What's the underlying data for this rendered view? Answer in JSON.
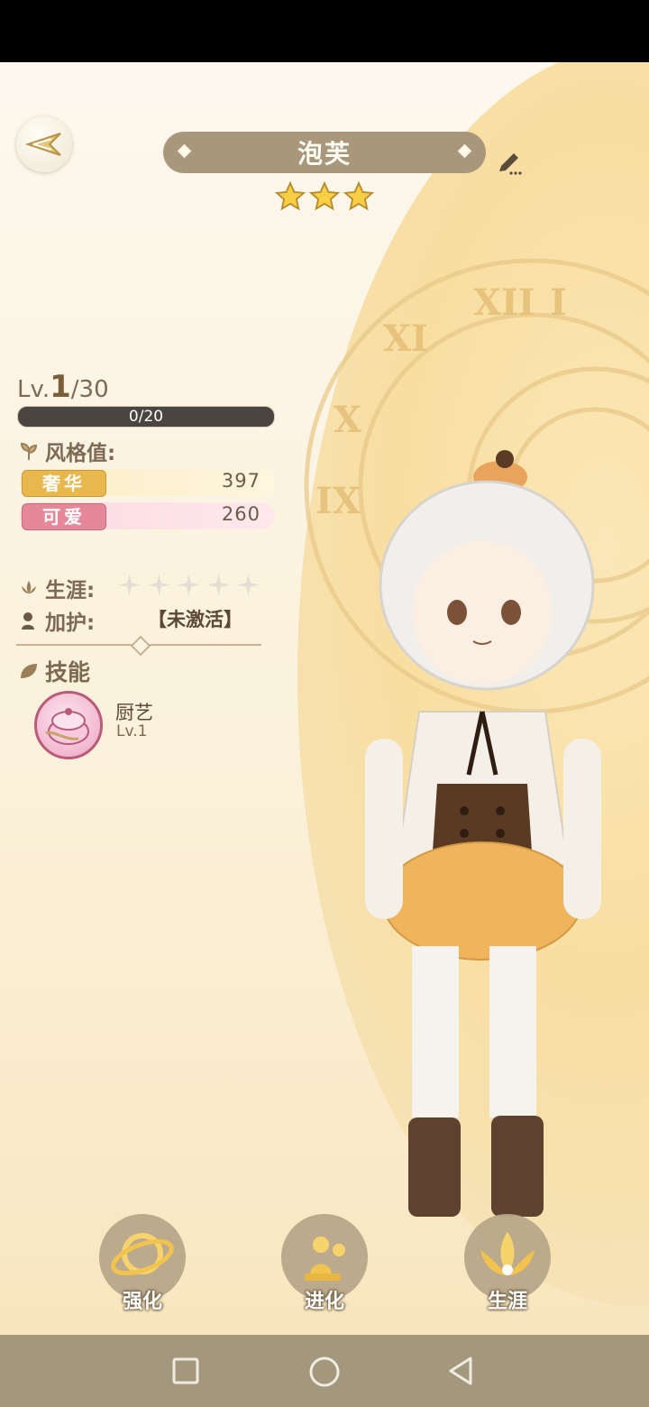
{
  "header": {
    "character_name": "泡芙",
    "rarity_stars": 3
  },
  "stats": {
    "level_prefix": "Lv.",
    "level_current": "1",
    "level_max": "/30",
    "xp_text": "0/20",
    "style_title": "风格值:",
    "styles": [
      {
        "tag": "奢华",
        "value": "397",
        "color": "#e8b84f"
      },
      {
        "tag": "可爱",
        "value": "260",
        "color": "#e4889a"
      }
    ],
    "career_label": "生涯:",
    "career_stars": 5,
    "protect_label": "加护:",
    "protect_value": "【未激活】"
  },
  "skills": {
    "title": "技能",
    "items": [
      {
        "name": "厨艺",
        "level": "Lv.1"
      }
    ]
  },
  "actions": [
    {
      "label": "强化",
      "icon": "ring-orbit-icon"
    },
    {
      "label": "进化",
      "icon": "chess-pawn-icon"
    },
    {
      "label": "生涯",
      "icon": "lotus-icon"
    }
  ],
  "colors": {
    "accent": "#a8977b",
    "scene_bg": "#fbf1da",
    "nav_bar": "#a3987d"
  }
}
